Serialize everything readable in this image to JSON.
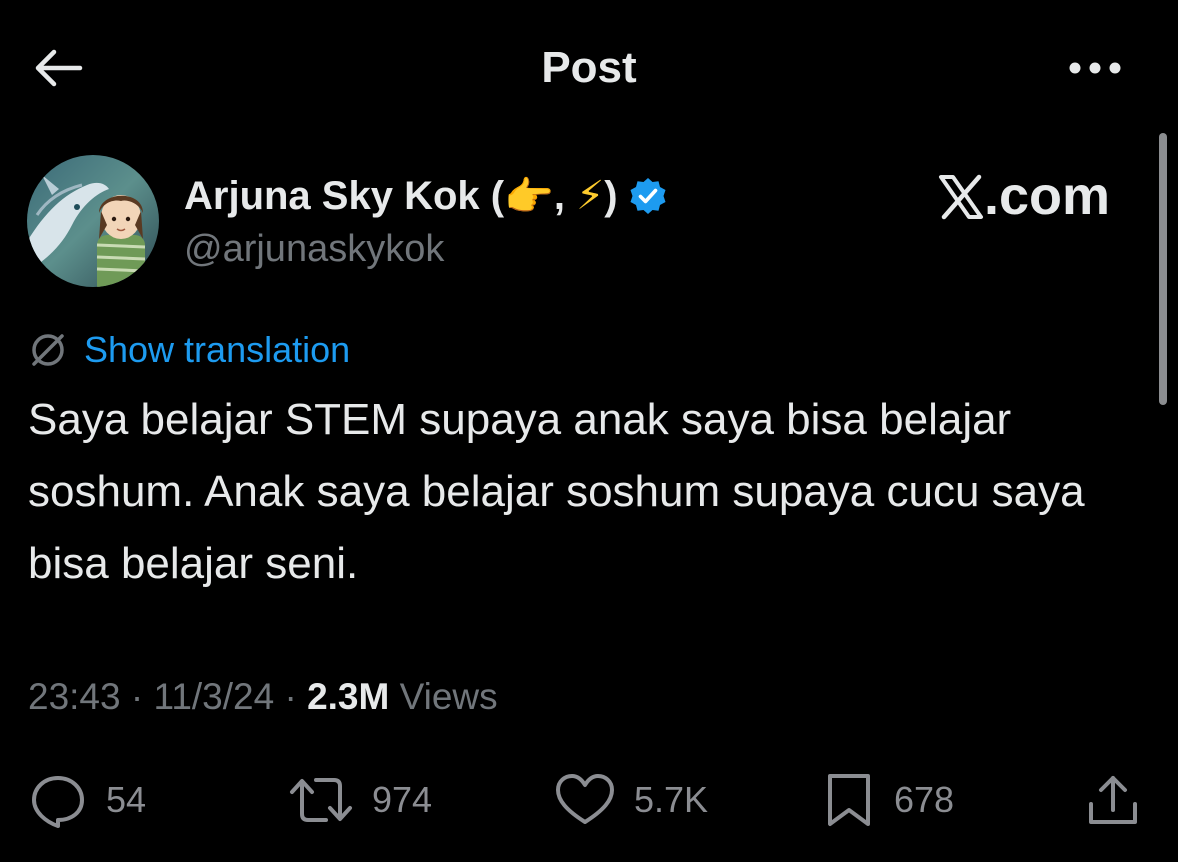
{
  "header": {
    "title": "Post",
    "back_icon": "arrow-left-icon",
    "more_icon": "more-horizontal-icon"
  },
  "author": {
    "display_name": "Arjuna Sky Kok (",
    "name_emoji_1": "👉",
    "name_separator": ", ",
    "name_emoji_2": "⚡",
    "name_close": ")",
    "handle": "@arjunaskykok",
    "verified_icon": "verified-badge-icon"
  },
  "watermark": {
    "suffix": ".com"
  },
  "translation": {
    "label": "Show translation",
    "icon": "globe-icon"
  },
  "post": {
    "text": "Saya belajar STEM supaya anak saya bisa belajar soshum. Anak saya belajar soshum supaya cucu saya bisa belajar seni.",
    "time": "23:43",
    "separator": " · ",
    "date": "11/3/24",
    "views_count": "2.3M",
    "views_label": " Views"
  },
  "actions": {
    "replies": "54",
    "reposts": "974",
    "likes": "5.7K",
    "bookmarks": "678"
  },
  "colors": {
    "background": "#000000",
    "text": "#e7e9ea",
    "secondary": "#71767b",
    "link": "#1d9bf0",
    "verified": "#1d9bf0"
  }
}
